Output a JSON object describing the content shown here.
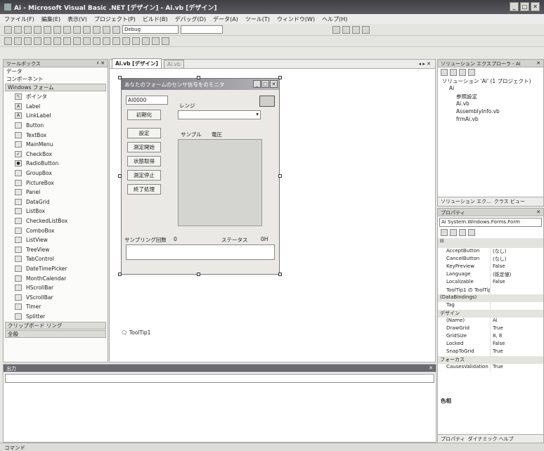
{
  "window": {
    "title": "Ai - Microsoft Visual Basic .NET [デザイン] - Ai.vb [デザイン]"
  },
  "menu": [
    "ファイル(F)",
    "編集(E)",
    "表示(V)",
    "プロジェクト(P)",
    "ビルド(B)",
    "デバッグ(D)",
    "データ(A)",
    "ツール(T)",
    "ウィンドウ(W)",
    "ヘルプ(H)"
  ],
  "toolbar": {
    "config_value": "Debug"
  },
  "toolbox": {
    "title": "ツールボックス",
    "pin": "♯ ✕",
    "sections": [
      "データ",
      "コンポーネント",
      "Windows フォーム"
    ],
    "items": [
      "ポインタ",
      "Label",
      "LinkLabel",
      "Button",
      "TextBox",
      "MainMenu",
      "CheckBox",
      "RadioButton",
      "GroupBox",
      "PictureBox",
      "Panel",
      "DataGrid",
      "ListBox",
      "CheckedListBox",
      "ComboBox",
      "ListView",
      "TreeView",
      "TabControl",
      "DateTimePicker",
      "MonthCalendar",
      "HScrollBar",
      "VScrollBar",
      "Timer",
      "Splitter"
    ],
    "bottom_sections": [
      "クリップボード リング",
      "全般"
    ]
  },
  "designer": {
    "tab_active": "Ai.vb [デザイン]",
    "tab_inactive": "Ai.vb"
  },
  "form": {
    "title": "あなたのフォームのセンサ信号をのモニタ",
    "textbox_value": "AI0000",
    "buttons": [
      "初期化",
      "設定",
      "測定開始",
      "状態取得",
      "測定停止",
      "終了処理"
    ],
    "range_label": "レンジ",
    "sample_header": "サンプル",
    "volt_header": "電圧",
    "sampling_label": "サンプリング回数",
    "sampling_value": "0",
    "status_label": "ステータス",
    "status_value": "0H"
  },
  "tray": {
    "item": "ToolTip1"
  },
  "solution": {
    "title": "ソリューション エクスプローラ - Ai",
    "tree": [
      "ソリューション 'Ai' (1 プロジェクト)",
      "Ai",
      "参照設定",
      "Ai.vb",
      "AssemblyInfo.vb",
      "frmAi.vb"
    ],
    "tabs": [
      "ソリューション エク...",
      "クラス ビュー"
    ]
  },
  "properties": {
    "title": "プロパティ",
    "object": "Ai System.Windows.Forms.Form",
    "rows": [
      {
        "type": "row",
        "name": "AcceptButton",
        "value": "(なし)"
      },
      {
        "type": "row",
        "name": "CancelButton",
        "value": "(なし)"
      },
      {
        "type": "row",
        "name": "KeyPreview",
        "value": "False"
      },
      {
        "type": "row",
        "name": "Language",
        "value": "(既定値)"
      },
      {
        "type": "row",
        "name": "Localizable",
        "value": "False"
      },
      {
        "type": "row",
        "name": "ToolTip1 の ToolTip",
        "value": ""
      },
      {
        "type": "cat",
        "name": "(DataBindings)"
      },
      {
        "type": "row",
        "name": "Tag",
        "value": ""
      },
      {
        "type": "cat",
        "name": "デザイン"
      },
      {
        "type": "row",
        "name": "(Name)",
        "value": "Ai"
      },
      {
        "type": "row",
        "name": "DrawGrid",
        "value": "True"
      },
      {
        "type": "row",
        "name": "GridSize",
        "value": "8, 8"
      },
      {
        "type": "row",
        "name": "Locked",
        "value": "False"
      },
      {
        "type": "row",
        "name": "SnapToGrid",
        "value": "True"
      },
      {
        "type": "cat",
        "name": "フォーカス"
      },
      {
        "type": "row",
        "name": "CausesValidation",
        "value": "True"
      }
    ],
    "desc_title": "色相",
    "tabs": [
      "プロパティ",
      "ダイナミック ヘルプ"
    ]
  },
  "output": {
    "title": "出力"
  },
  "status": {
    "text": "コマンド"
  }
}
